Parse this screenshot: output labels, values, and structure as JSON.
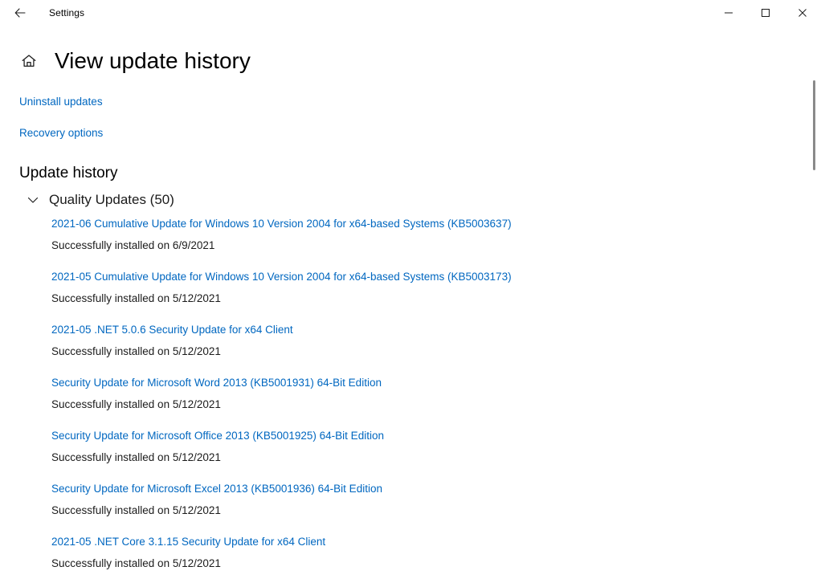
{
  "window": {
    "app_title": "Settings",
    "back_icon": "back-arrow-icon",
    "minimize_label": "—",
    "maximize_label": "□",
    "close_label": "✕"
  },
  "page": {
    "home_icon": "home-icon",
    "title": "View update history"
  },
  "links": [
    {
      "label": "Uninstall updates"
    },
    {
      "label": "Recovery options"
    }
  ],
  "section": {
    "header": "Update history"
  },
  "group": {
    "chevron_icon": "chevron-down-icon",
    "label": "Quality Updates (50)"
  },
  "updates": [
    {
      "title": "2021-06 Cumulative Update for Windows 10 Version 2004 for x64-based Systems (KB5003637)",
      "status": "Successfully installed on 6/9/2021"
    },
    {
      "title": "2021-05 Cumulative Update for Windows 10 Version 2004 for x64-based Systems (KB5003173)",
      "status": "Successfully installed on 5/12/2021"
    },
    {
      "title": "2021-05 .NET 5.0.6 Security Update for x64 Client",
      "status": "Successfully installed on 5/12/2021"
    },
    {
      "title": "Security Update for Microsoft Word 2013 (KB5001931) 64-Bit Edition",
      "status": "Successfully installed on 5/12/2021"
    },
    {
      "title": "Security Update for Microsoft Office 2013 (KB5001925) 64-Bit Edition",
      "status": "Successfully installed on 5/12/2021"
    },
    {
      "title": "Security Update for Microsoft Excel 2013 (KB5001936) 64-Bit Edition",
      "status": "Successfully installed on 5/12/2021"
    },
    {
      "title": "2021-05 .NET Core 3.1.15 Security Update for x64 Client",
      "status": "Successfully installed on 5/12/2021"
    }
  ],
  "colors": {
    "link": "#0067c0",
    "text": "#000000",
    "background": "#ffffff",
    "scrollbar_thumb": "#8a8a8a"
  }
}
